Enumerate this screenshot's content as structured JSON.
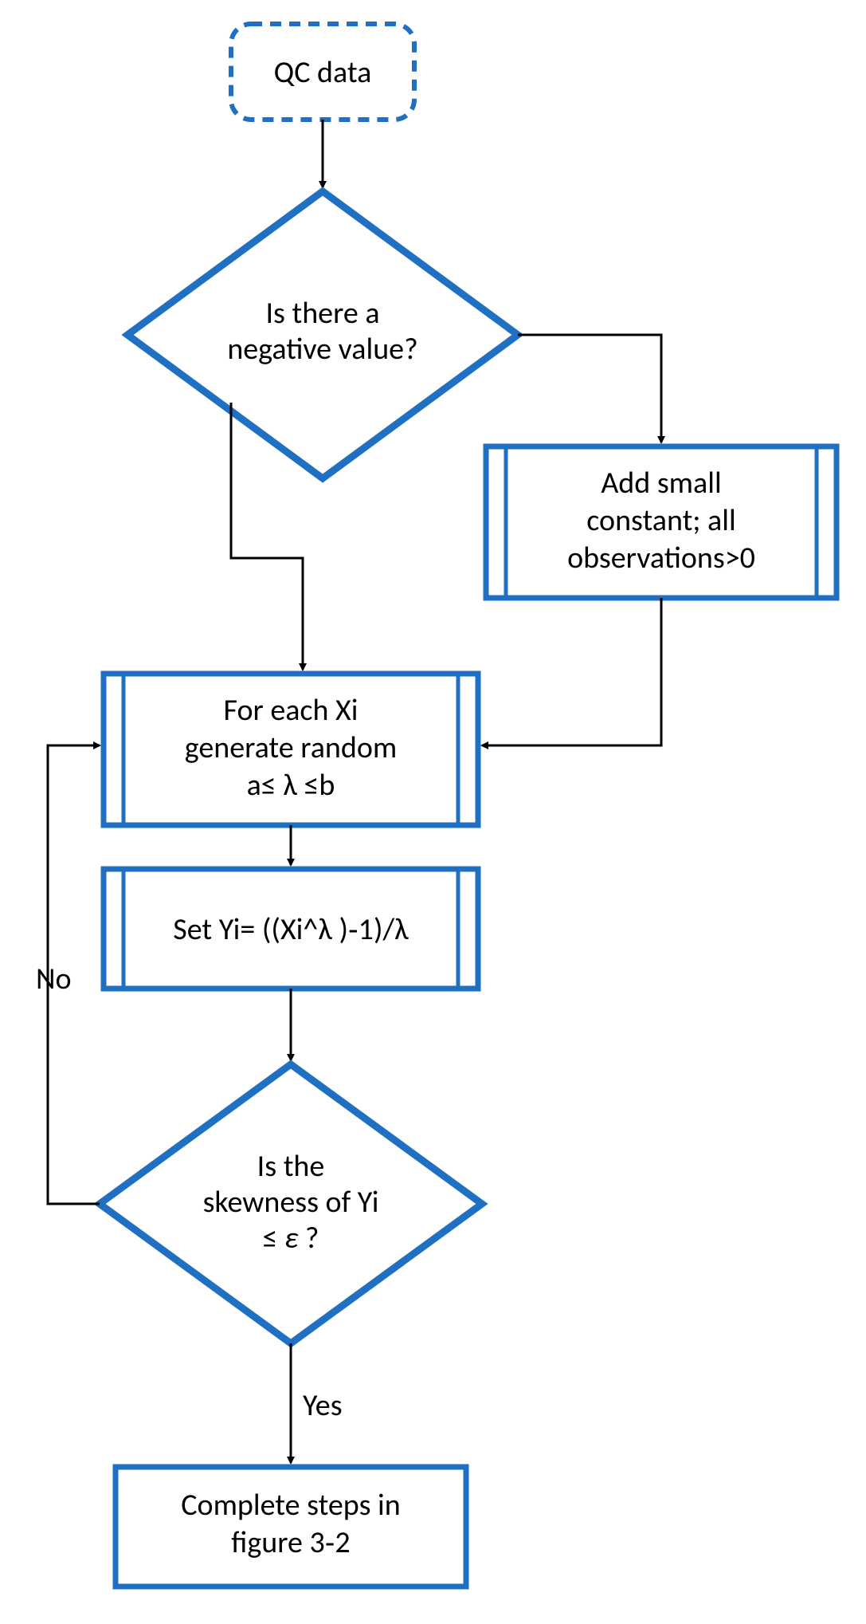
{
  "nodes": {
    "start": {
      "label": "QC data"
    },
    "decision1": {
      "l1": "Is there a",
      "l2": "negative value?"
    },
    "process_add": {
      "l1": "Add small",
      "l2": "constant; all",
      "l3": "observations>0"
    },
    "process_gen": {
      "l1": "For each Xi",
      "l2": "generate random",
      "l3": "a≤   λ ≤b"
    },
    "process_set": {
      "l1": "Set Yi= ((Xi^λ )‑1)/λ"
    },
    "decision2": {
      "l1": "Is the",
      "l2": "skewness of Yi",
      "l3a": "≤ ",
      "l3b": "ε",
      "l3c": " ?"
    },
    "end": {
      "l1": "Complete steps in",
      "l2": "figure 3‑2"
    }
  },
  "edges": {
    "no": "No",
    "yes": "Yes"
  },
  "colors": {
    "stroke": "#1f6fc2",
    "arrow": "#000000"
  }
}
